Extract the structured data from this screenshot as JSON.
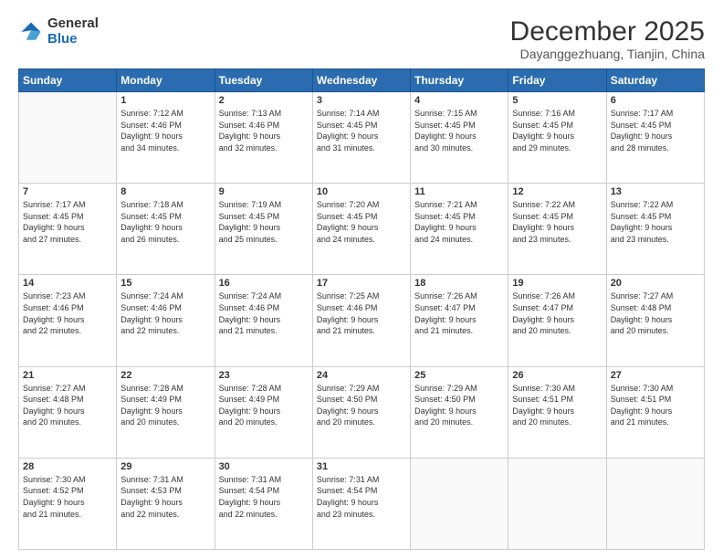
{
  "logo": {
    "general": "General",
    "blue": "Blue"
  },
  "header": {
    "title": "December 2025",
    "subtitle": "Dayanggezhuang, Tianjin, China"
  },
  "weekdays": [
    "Sunday",
    "Monday",
    "Tuesday",
    "Wednesday",
    "Thursday",
    "Friday",
    "Saturday"
  ],
  "weeks": [
    [
      {
        "day": "",
        "info": ""
      },
      {
        "day": "1",
        "info": "Sunrise: 7:12 AM\nSunset: 4:46 PM\nDaylight: 9 hours\nand 34 minutes."
      },
      {
        "day": "2",
        "info": "Sunrise: 7:13 AM\nSunset: 4:46 PM\nDaylight: 9 hours\nand 32 minutes."
      },
      {
        "day": "3",
        "info": "Sunrise: 7:14 AM\nSunset: 4:45 PM\nDaylight: 9 hours\nand 31 minutes."
      },
      {
        "day": "4",
        "info": "Sunrise: 7:15 AM\nSunset: 4:45 PM\nDaylight: 9 hours\nand 30 minutes."
      },
      {
        "day": "5",
        "info": "Sunrise: 7:16 AM\nSunset: 4:45 PM\nDaylight: 9 hours\nand 29 minutes."
      },
      {
        "day": "6",
        "info": "Sunrise: 7:17 AM\nSunset: 4:45 PM\nDaylight: 9 hours\nand 28 minutes."
      }
    ],
    [
      {
        "day": "7",
        "info": "Sunrise: 7:17 AM\nSunset: 4:45 PM\nDaylight: 9 hours\nand 27 minutes."
      },
      {
        "day": "8",
        "info": "Sunrise: 7:18 AM\nSunset: 4:45 PM\nDaylight: 9 hours\nand 26 minutes."
      },
      {
        "day": "9",
        "info": "Sunrise: 7:19 AM\nSunset: 4:45 PM\nDaylight: 9 hours\nand 25 minutes."
      },
      {
        "day": "10",
        "info": "Sunrise: 7:20 AM\nSunset: 4:45 PM\nDaylight: 9 hours\nand 24 minutes."
      },
      {
        "day": "11",
        "info": "Sunrise: 7:21 AM\nSunset: 4:45 PM\nDaylight: 9 hours\nand 24 minutes."
      },
      {
        "day": "12",
        "info": "Sunrise: 7:22 AM\nSunset: 4:45 PM\nDaylight: 9 hours\nand 23 minutes."
      },
      {
        "day": "13",
        "info": "Sunrise: 7:22 AM\nSunset: 4:45 PM\nDaylight: 9 hours\nand 23 minutes."
      }
    ],
    [
      {
        "day": "14",
        "info": "Sunrise: 7:23 AM\nSunset: 4:46 PM\nDaylight: 9 hours\nand 22 minutes."
      },
      {
        "day": "15",
        "info": "Sunrise: 7:24 AM\nSunset: 4:46 PM\nDaylight: 9 hours\nand 22 minutes."
      },
      {
        "day": "16",
        "info": "Sunrise: 7:24 AM\nSunset: 4:46 PM\nDaylight: 9 hours\nand 21 minutes."
      },
      {
        "day": "17",
        "info": "Sunrise: 7:25 AM\nSunset: 4:46 PM\nDaylight: 9 hours\nand 21 minutes."
      },
      {
        "day": "18",
        "info": "Sunrise: 7:26 AM\nSunset: 4:47 PM\nDaylight: 9 hours\nand 21 minutes."
      },
      {
        "day": "19",
        "info": "Sunrise: 7:26 AM\nSunset: 4:47 PM\nDaylight: 9 hours\nand 20 minutes."
      },
      {
        "day": "20",
        "info": "Sunrise: 7:27 AM\nSunset: 4:48 PM\nDaylight: 9 hours\nand 20 minutes."
      }
    ],
    [
      {
        "day": "21",
        "info": "Sunrise: 7:27 AM\nSunset: 4:48 PM\nDaylight: 9 hours\nand 20 minutes."
      },
      {
        "day": "22",
        "info": "Sunrise: 7:28 AM\nSunset: 4:49 PM\nDaylight: 9 hours\nand 20 minutes."
      },
      {
        "day": "23",
        "info": "Sunrise: 7:28 AM\nSunset: 4:49 PM\nDaylight: 9 hours\nand 20 minutes."
      },
      {
        "day": "24",
        "info": "Sunrise: 7:29 AM\nSunset: 4:50 PM\nDaylight: 9 hours\nand 20 minutes."
      },
      {
        "day": "25",
        "info": "Sunrise: 7:29 AM\nSunset: 4:50 PM\nDaylight: 9 hours\nand 20 minutes."
      },
      {
        "day": "26",
        "info": "Sunrise: 7:30 AM\nSunset: 4:51 PM\nDaylight: 9 hours\nand 20 minutes."
      },
      {
        "day": "27",
        "info": "Sunrise: 7:30 AM\nSunset: 4:51 PM\nDaylight: 9 hours\nand 21 minutes."
      }
    ],
    [
      {
        "day": "28",
        "info": "Sunrise: 7:30 AM\nSunset: 4:52 PM\nDaylight: 9 hours\nand 21 minutes."
      },
      {
        "day": "29",
        "info": "Sunrise: 7:31 AM\nSunset: 4:53 PM\nDaylight: 9 hours\nand 22 minutes."
      },
      {
        "day": "30",
        "info": "Sunrise: 7:31 AM\nSunset: 4:54 PM\nDaylight: 9 hours\nand 22 minutes."
      },
      {
        "day": "31",
        "info": "Sunrise: 7:31 AM\nSunset: 4:54 PM\nDaylight: 9 hours\nand 23 minutes."
      },
      {
        "day": "",
        "info": ""
      },
      {
        "day": "",
        "info": ""
      },
      {
        "day": "",
        "info": ""
      }
    ]
  ]
}
